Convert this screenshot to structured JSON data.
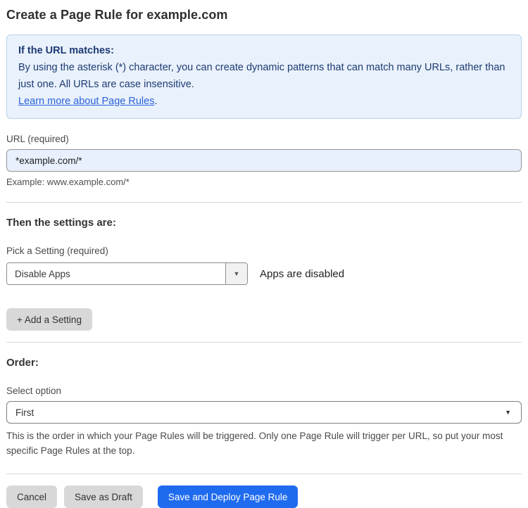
{
  "page": {
    "title": "Create a Page Rule for example.com"
  },
  "info_box": {
    "heading": "If the URL matches:",
    "body": "By using the asterisk (*) character, you can create dynamic patterns that can match many URLs, rather than just one. All URLs are case insensitive.",
    "link_label": "Learn more about Page Rules",
    "link_suffix": "."
  },
  "url_field": {
    "label": "URL (required)",
    "value": "*example.com/*",
    "helper": "Example: www.example.com/*"
  },
  "settings_section": {
    "heading": "Then the settings are:",
    "picker_label": "Pick a Setting (required)",
    "picker_value": "Disable Apps",
    "picker_note": "Apps are disabled",
    "add_setting_label": "+ Add a Setting"
  },
  "order_section": {
    "heading": "Order:",
    "select_label": "Select option",
    "select_value": "First",
    "helper": "This is the order in which your Page Rules will be triggered. Only one Page Rule will trigger per URL, so put your most specific Page Rules at the top."
  },
  "footer": {
    "cancel_label": "Cancel",
    "save_draft_label": "Save as Draft",
    "save_deploy_label": "Save and Deploy Page Rule"
  },
  "glyphs": {
    "caret_down": "▼"
  },
  "colors": {
    "info_bg": "#e9f1fc",
    "info_border": "#b9d3ee",
    "info_text": "#1d3b72",
    "link": "#2b62d9",
    "input_bg": "#e8f0fe",
    "primary_button": "#1f6bf0",
    "gray_button": "#d8d8d8"
  }
}
